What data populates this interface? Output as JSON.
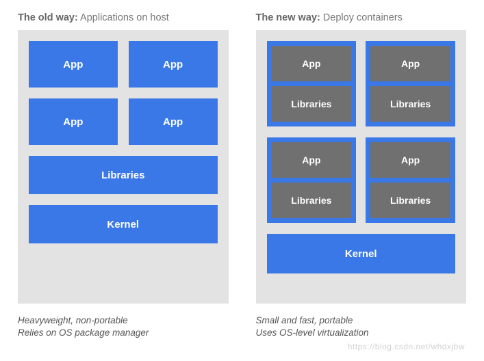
{
  "old": {
    "heading_bold": "The old way:",
    "heading_rest": " Applications on host",
    "app": "App",
    "libraries": "Libraries",
    "kernel": "Kernel",
    "caption_line1": "Heavyweight, non-portable",
    "caption_line2": "Relies on OS package manager"
  },
  "new": {
    "heading_bold": "The new way:",
    "heading_rest": " Deploy containers",
    "app": "App",
    "libraries": "Libraries",
    "kernel": "Kernel",
    "caption_line1": "Small and fast, portable",
    "caption_line2": "Uses OS-level virtualization"
  },
  "watermark": "https://blog.csdn.net/whdxjbw"
}
